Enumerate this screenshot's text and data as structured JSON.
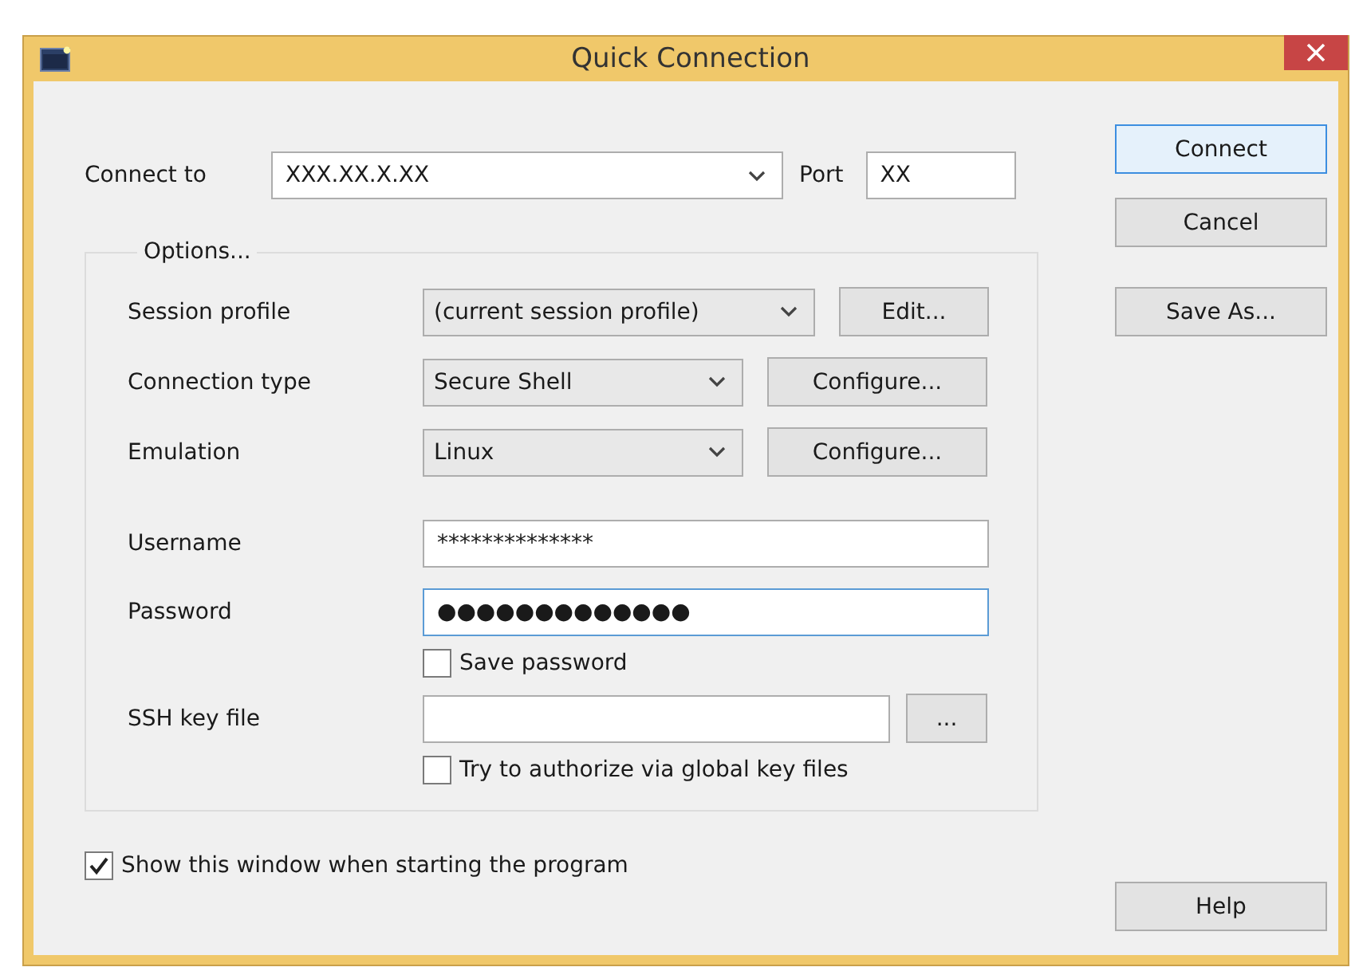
{
  "window": {
    "title": "Quick Connection"
  },
  "connect_to": {
    "label": "Connect to",
    "value": "XXX.XX.X.XX"
  },
  "port": {
    "label": "Port",
    "value": "XX"
  },
  "options": {
    "title": "Options...",
    "rows": [
      {
        "kind": "combo",
        "label": "Session profile",
        "value": "(current session profile)",
        "button": "Edit..."
      },
      {
        "kind": "combo",
        "label": "Connection type",
        "value": "Secure Shell",
        "button": "Configure..."
      },
      {
        "kind": "combo",
        "label": "Emulation",
        "value": "Linux",
        "button": "Configure..."
      },
      {
        "kind": "field",
        "label": "Username",
        "value": "**************",
        "focused": false
      },
      {
        "kind": "field",
        "label": "Password",
        "value": "●●●●●●●●●●●●●",
        "focused": true
      },
      {
        "kind": "checkbox",
        "label": "Save password",
        "checked": false
      },
      {
        "kind": "file",
        "label": "SSH key file",
        "button": "..."
      },
      {
        "kind": "checkbox",
        "label": "Try to authorize via global key files",
        "checked": false
      }
    ]
  },
  "show_on_start": {
    "label": "Show this window when starting the program",
    "checked": true
  },
  "buttons": [
    {
      "label": "Connect",
      "default": true
    },
    {
      "label": "Cancel",
      "default": false
    },
    {
      "label": "Save As...",
      "default": false
    }
  ],
  "help_button": "Help"
}
